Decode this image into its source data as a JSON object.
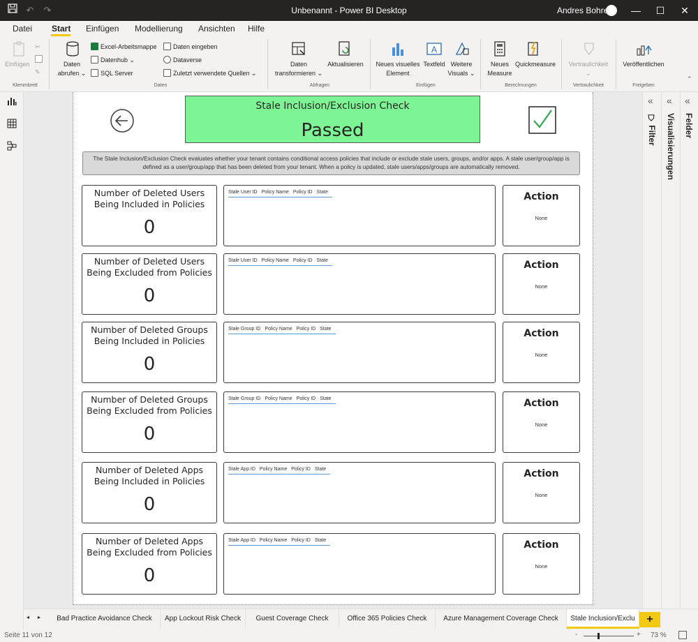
{
  "window": {
    "title": "Unbenannt - Power BI Desktop",
    "user": "Andres Bohren"
  },
  "menu": [
    "Datei",
    "Start",
    "Einfügen",
    "Modellierung",
    "Ansichten",
    "Hilfe"
  ],
  "ribbon": {
    "einfuegen": "Einfügen",
    "klemmbrett": "Klemmbrett",
    "daten_abrufen_1": "Daten",
    "daten_abrufen_2": "abrufen ⌄",
    "excel": "Excel-Arbeitsmappe",
    "datenhub": "Datenhub ⌄",
    "sql": "SQL Server",
    "daten_eingeben": "Daten eingeben",
    "dataverse": "Dataverse",
    "zuletzt": "Zuletzt verwendete Quellen ⌄",
    "group_daten": "Daten",
    "transformieren_1": "Daten",
    "transformieren_2": "transformieren ⌄",
    "aktualisieren": "Aktualisieren",
    "group_abfragen": "Abfragen",
    "neues_visuelles_1": "Neues visuelles",
    "neues_visuelles_2": "Element",
    "textfeld": "Textfeld",
    "weitere_1": "Weitere",
    "weitere_2": "Visuals ⌄",
    "group_einfuegen": "Einfügen",
    "neues_measure_1": "Neues",
    "neues_measure_2": "Measure",
    "quickmeasure": "Quickmeasure",
    "group_berechnungen": "Berechnungen",
    "vertraulichkeit": "Vertraulichkeit",
    "group_vertraulichkeit": "Vertraulichkeit",
    "veroeffentlichen": "Veröffentlichen",
    "group_freigeben": "Freigeben"
  },
  "panes": {
    "filter": "Filter",
    "visualisierungen": "Visualisierungen",
    "felder": "Felder"
  },
  "report": {
    "title": "Stale Inclusion/Exclusion Check",
    "status": "Passed",
    "description": "The Stale Inclusion/Exclusion Check evaluates whether your tenant contains conditional access policies that include or exclude stale users, groups, and/or apps. A stale user/group/app is defined as a user/group/app that has been deleted from your tenant. When a policy is updated, stale users/apps/groups are automatically removed.",
    "rows": [
      {
        "card_title": "Number of Deleted Users Being Included in Policies",
        "value": "0",
        "columns": [
          "Stale User ID",
          "Policy Name",
          "Policy ID",
          "State"
        ],
        "action_title": "Action",
        "action": "None"
      },
      {
        "card_title": "Number of Deleted Users Being Excluded from Policies",
        "value": "0",
        "columns": [
          "Stale User ID",
          "Policy Name",
          "Policy ID",
          "State"
        ],
        "action_title": "Action",
        "action": "None"
      },
      {
        "card_title": "Number of Deleted Groups Being Included in Policies",
        "value": "0",
        "columns": [
          "Stale Group ID",
          "Policy Name",
          "Policy ID",
          "State"
        ],
        "action_title": "Action",
        "action": "None"
      },
      {
        "card_title": "Number of Deleted Groups Being Excluded from Policies",
        "value": "0",
        "columns": [
          "Stale Group ID",
          "Policy Name",
          "Policy ID",
          "State"
        ],
        "action_title": "Action",
        "action": "None"
      },
      {
        "card_title": "Number of Deleted Apps Being Included in Policies",
        "value": "0",
        "columns": [
          "Stale App ID",
          "Policy Name",
          "Policy ID",
          "State"
        ],
        "action_title": "Action",
        "action": "None"
      },
      {
        "card_title": "Number of Deleted Apps Being Excluded from Policies",
        "value": "0",
        "columns": [
          "Stale App ID",
          "Policy Name",
          "Policy ID",
          "State"
        ],
        "action_title": "Action",
        "action": "None"
      }
    ]
  },
  "tabs": [
    "Bad Practice Avoidance Check",
    "App Lockout Risk Check",
    "Guest Coverage Check",
    "Office 365 Policies Check",
    "Azure Management Coverage Check",
    "Stale Inclusion/Exclu"
  ],
  "status": {
    "page": "Seite 11 von 12",
    "zoom": "73 %"
  },
  "colors": {
    "passed_bg": "#7ef595",
    "accent": "#f2c811",
    "check": "#2fa84f"
  }
}
